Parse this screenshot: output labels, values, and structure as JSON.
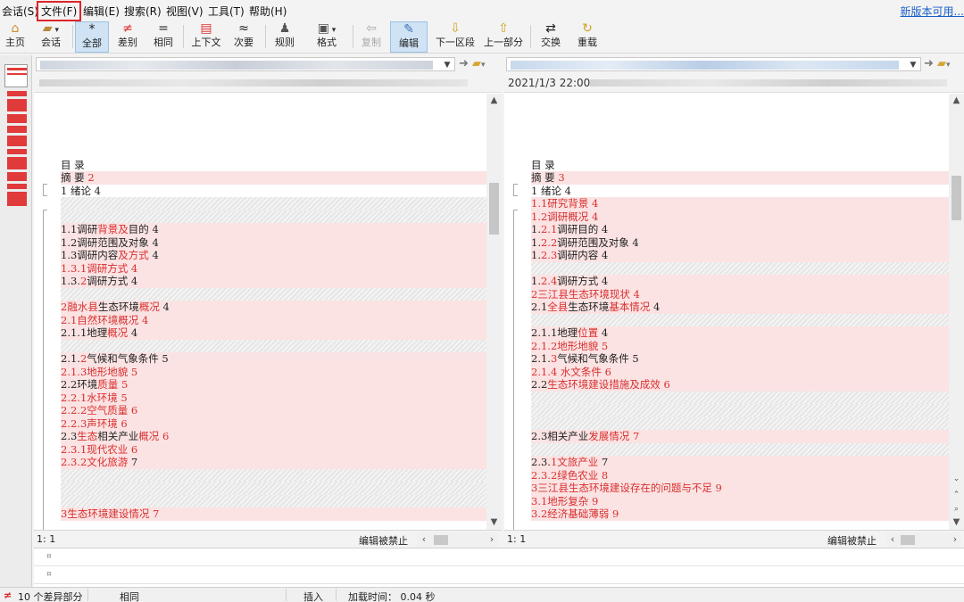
{
  "menu": {
    "items": [
      "会话(S)",
      "文件(F)",
      "编辑(E)",
      "搜索(R)",
      "视图(V)",
      "工具(T)",
      "帮助(H)"
    ],
    "update_link": "新版本可用..."
  },
  "toolbar": {
    "home": "主页",
    "session": "会话",
    "all": "全部",
    "diffs": "差别",
    "same": "相同",
    "context": "上下文",
    "minor": "次要",
    "rules": "规则",
    "format": "格式",
    "copy": "复制",
    "edit": "编辑",
    "next_section": "下一区段",
    "prev_section": "上一部分",
    "swap": "交换",
    "reload": "重载"
  },
  "left_pane": {
    "info_prefix": "",
    "position": "1: 1",
    "edit_status": "编辑被禁止",
    "lines": [
      {
        "t": "blank",
        "s": []
      },
      {
        "t": "blank",
        "s": []
      },
      {
        "t": "blank",
        "s": []
      },
      {
        "t": "blank",
        "s": []
      },
      {
        "t": "blank",
        "s": []
      },
      {
        "t": "blank",
        "s": [
          [
            "n",
            "目 录"
          ]
        ]
      },
      {
        "t": "diff",
        "s": [
          [
            "n",
            "摘 要   "
          ],
          [
            "r",
            "2"
          ]
        ]
      },
      {
        "t": "blank",
        "s": [
          [
            "n",
            "1 绪论  4"
          ]
        ]
      },
      {
        "t": "gap",
        "s": []
      },
      {
        "t": "gap",
        "s": []
      },
      {
        "t": "diff",
        "s": [
          [
            "n",
            "1.1调研"
          ],
          [
            "r",
            "背景及"
          ],
          [
            "n",
            "目的          4"
          ]
        ]
      },
      {
        "t": "diff",
        "s": [
          [
            "n",
            "1.2调研范围及对象        4"
          ]
        ]
      },
      {
        "t": "diff",
        "s": [
          [
            "n",
            "1.3调研内容"
          ],
          [
            "r",
            "及方式"
          ],
          [
            "n",
            "        4"
          ]
        ]
      },
      {
        "t": "diff",
        "s": [
          [
            "r",
            "1.3.1调研方式    4"
          ]
        ]
      },
      {
        "t": "diff",
        "s": [
          [
            "n",
            "1.3."
          ],
          [
            "r",
            "2"
          ],
          [
            "n",
            "调研方式    4"
          ]
        ]
      },
      {
        "t": "gap",
        "s": []
      },
      {
        "t": "diff",
        "s": [
          [
            "r",
            "2融水县"
          ],
          [
            "n",
            "生态环境"
          ],
          [
            "r",
            "概况"
          ],
          [
            "n",
            "        4"
          ]
        ]
      },
      {
        "t": "diff",
        "s": [
          [
            "r",
            "2.1自然环境概况  4"
          ]
        ]
      },
      {
        "t": "diff",
        "s": [
          [
            "n",
            "2.1.1地理"
          ],
          [
            "r",
            "概况"
          ],
          [
            "n",
            "    4"
          ]
        ]
      },
      {
        "t": "gap",
        "s": []
      },
      {
        "t": "diff",
        "s": [
          [
            "n",
            "2.1."
          ],
          [
            "r",
            "2"
          ],
          [
            "n",
            "气候和气象条件    5"
          ]
        ]
      },
      {
        "t": "diff",
        "s": [
          [
            "r",
            "2.1.3地形地貌    5"
          ]
        ]
      },
      {
        "t": "diff",
        "s": [
          [
            "n",
            "2.2环境"
          ],
          [
            "r",
            "质量"
          ],
          [
            "n",
            "        "
          ],
          [
            "r",
            "5"
          ]
        ]
      },
      {
        "t": "diff",
        "s": [
          [
            "r",
            "2.2.1水环境      5"
          ]
        ]
      },
      {
        "t": "diff",
        "s": [
          [
            "r",
            "2.2.2空气质量    6"
          ]
        ]
      },
      {
        "t": "diff",
        "s": [
          [
            "r",
            "2.2.3声环境      6"
          ]
        ]
      },
      {
        "t": "diff",
        "s": [
          [
            "n",
            "2.3"
          ],
          [
            "r",
            "生态"
          ],
          [
            "n",
            "相关产业"
          ],
          [
            "r",
            "概况"
          ],
          [
            "n",
            "        "
          ],
          [
            "r",
            "6"
          ]
        ]
      },
      {
        "t": "diff",
        "s": [
          [
            "r",
            "2.3.1现代农业    6"
          ]
        ]
      },
      {
        "t": "diff",
        "s": [
          [
            "r",
            "2.3.2文化旅游"
          ],
          [
            "n",
            "    7"
          ]
        ]
      },
      {
        "t": "gap",
        "s": []
      },
      {
        "t": "gap",
        "s": []
      },
      {
        "t": "gap",
        "s": []
      },
      {
        "t": "diff",
        "s": [
          [
            "r",
            "3生态环境建设情况"
          ],
          [
            "n",
            "        "
          ],
          [
            "r",
            "7"
          ]
        ]
      }
    ]
  },
  "right_pane": {
    "timestamp": "2021/1/3 22:00:",
    "position": "1: 1",
    "edit_status": "编辑被禁止",
    "lines": [
      {
        "t": "blank",
        "s": []
      },
      {
        "t": "blank",
        "s": []
      },
      {
        "t": "blank",
        "s": []
      },
      {
        "t": "blank",
        "s": []
      },
      {
        "t": "blank",
        "s": []
      },
      {
        "t": "blank",
        "s": [
          [
            "n",
            "目 录"
          ]
        ]
      },
      {
        "t": "diff",
        "s": [
          [
            "n",
            "摘 要   "
          ],
          [
            "r",
            "3"
          ]
        ]
      },
      {
        "t": "blank",
        "s": [
          [
            "n",
            "1 绪论  4"
          ]
        ]
      },
      {
        "t": "diff",
        "s": [
          [
            "r",
            "1.1研究背景      4"
          ]
        ]
      },
      {
        "t": "diff",
        "s": [
          [
            "r",
            "1.2调研概况      4"
          ]
        ]
      },
      {
        "t": "diff",
        "s": [
          [
            "n",
            "1."
          ],
          [
            "r",
            "2.1"
          ],
          [
            "n",
            "调研目的    4"
          ]
        ]
      },
      {
        "t": "diff",
        "s": [
          [
            "n",
            "1."
          ],
          [
            "r",
            "2.2"
          ],
          [
            "n",
            "调研范围及对象        4"
          ]
        ]
      },
      {
        "t": "diff",
        "s": [
          [
            "n",
            "1."
          ],
          [
            "r",
            "2.3"
          ],
          [
            "n",
            "调研内容    4"
          ]
        ]
      },
      {
        "t": "gap",
        "s": []
      },
      {
        "t": "diff",
        "s": [
          [
            "n",
            "1."
          ],
          [
            "r",
            "2.4"
          ],
          [
            "n",
            "调研方式    4"
          ]
        ]
      },
      {
        "t": "diff",
        "s": [
          [
            "r",
            "2三江县生态环境现状        4"
          ]
        ]
      },
      {
        "t": "diff",
        "s": [
          [
            "n",
            "2.1"
          ],
          [
            "r",
            "全县"
          ],
          [
            "n",
            "生态环境"
          ],
          [
            "r",
            "基本情况"
          ],
          [
            "n",
            " 4"
          ]
        ]
      },
      {
        "t": "gap",
        "s": []
      },
      {
        "t": "diff",
        "s": [
          [
            "n",
            "2.1.1地理"
          ],
          [
            "r",
            "位置"
          ],
          [
            "n",
            "    4"
          ]
        ]
      },
      {
        "t": "diff",
        "s": [
          [
            "r",
            "2.1.2地形地貌    5"
          ]
        ]
      },
      {
        "t": "diff",
        "s": [
          [
            "n",
            "2.1."
          ],
          [
            "r",
            "3"
          ],
          [
            "n",
            "气候和气象条件        5"
          ]
        ]
      },
      {
        "t": "diff",
        "s": [
          [
            "r",
            "2.1.4 水文条件   6"
          ]
        ]
      },
      {
        "t": "diff",
        "s": [
          [
            "n",
            "2.2"
          ],
          [
            "r",
            "生态环境建设措施及成效           6"
          ]
        ]
      },
      {
        "t": "gap",
        "s": []
      },
      {
        "t": "gap",
        "s": []
      },
      {
        "t": "gap",
        "s": []
      },
      {
        "t": "diff",
        "s": [
          [
            "n",
            "2.3相关产业"
          ],
          [
            "r",
            "发展情况"
          ],
          [
            "n",
            "        "
          ],
          [
            "r",
            "7"
          ]
        ]
      },
      {
        "t": "gap",
        "s": []
      },
      {
        "t": "diff",
        "s": [
          [
            "n",
            "2.3."
          ],
          [
            "r",
            "1文旅产业"
          ],
          [
            "n",
            "    7"
          ]
        ]
      },
      {
        "t": "diff",
        "s": [
          [
            "r",
            "2.3.2绿色农业    8"
          ]
        ]
      },
      {
        "t": "diff",
        "s": [
          [
            "r",
            "3三江县生态环境建设存在的问题与不足         9"
          ]
        ]
      },
      {
        "t": "diff",
        "s": [
          [
            "r",
            "3.1地形复杂      9"
          ]
        ]
      },
      {
        "t": "diff",
        "s": [
          [
            "r",
            "3.2经济基础薄弱"
          ],
          [
            "n",
            " "
          ],
          [
            "r",
            "9"
          ]
        ]
      }
    ]
  },
  "detail": {
    "mark": "¤"
  },
  "statusbar": {
    "diff_count": "10 个差异部分",
    "same": "相同",
    "insert": "插入",
    "load_time": "加载时间： 0.04 秒"
  },
  "colors": {
    "diff_bg": "#fbe3e3",
    "diff_text": "#d92f2f",
    "accent": "#e0242b"
  }
}
